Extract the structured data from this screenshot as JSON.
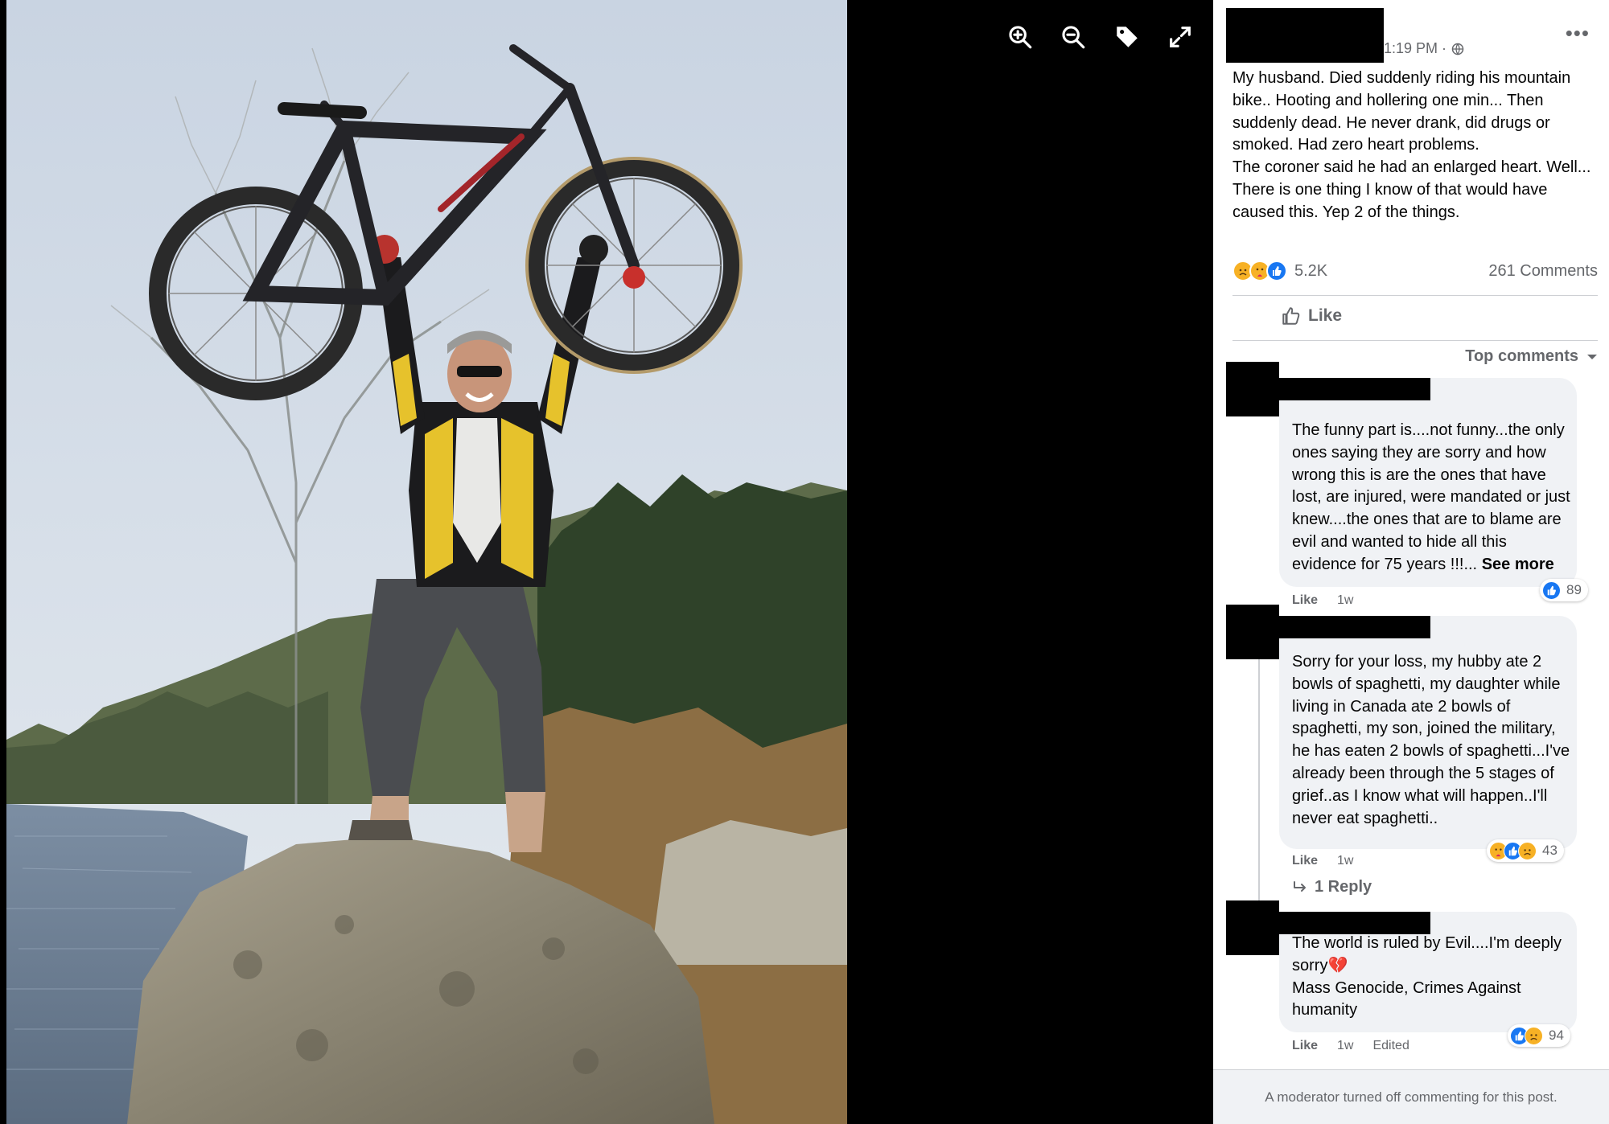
{
  "viewer": {
    "zoom_in_icon": "zoom-in-icon",
    "zoom_out_icon": "zoom-out-icon",
    "tag_icon": "tag-icon",
    "fullscreen_icon": "fullscreen-icon"
  },
  "post": {
    "time": "1:19 PM ·",
    "privacy_icon": "globe-icon",
    "more_label": "•••",
    "text": "My husband. Died suddenly riding his mountain bike.. Hooting and hollering one min... Then suddenly dead. He never drank, did drugs or smoked. Had zero heart problems.\nThe coroner said he had an enlarged heart. Well... There is one thing I know of that would have caused this. Yep 2 of the things.",
    "reaction_icons": [
      "sad-icon",
      "care-icon",
      "like-icon"
    ],
    "reaction_count": "5.2K",
    "comments_count": "261 Comments",
    "like_label": "Like",
    "top_comments_label": "Top comments"
  },
  "comments": [
    {
      "text": "The funny part is....not funny...the only ones saying they are sorry and how wrong this is are the ones that have lost, are injured, were mandated or just knew....the ones that are to blame are evil and wanted to hide all this evidence for 75 years !!!...",
      "see_more": "See more",
      "like_label": "Like",
      "time": "1w",
      "reactions": [
        "like-icon"
      ],
      "reaction_count": "89"
    },
    {
      "text": "Sorry for your loss, my hubby ate 2 bowls of spaghetti, my daughter while living in Canada ate 2 bowls of spaghetti, my son, joined the military, he has eaten 2 bowls of spaghetti...I've already been through the 5 stages of grief..as I know what will happen..I'll never eat spaghetti..",
      "like_label": "Like",
      "time": "1w",
      "reactions": [
        "care-icon",
        "like-icon",
        "sad-icon"
      ],
      "reaction_count": "43",
      "reply_label": "1 Reply"
    },
    {
      "text": "The world is ruled by Evil....I'm deeply sorry",
      "emoji": "💔",
      "text2": "Mass Genocide, Crimes Against humanity",
      "like_label": "Like",
      "time": "1w",
      "edited": "Edited",
      "reactions": [
        "like-icon",
        "sad-icon"
      ],
      "reaction_count": "94"
    }
  ],
  "footer": {
    "text": "A moderator turned off commenting for this post."
  },
  "colors": {
    "like_blue": "#1877f2",
    "sad_yellow": "#f7b125",
    "secondary_text": "#65676b",
    "bubble_bg": "#f0f2f5"
  }
}
